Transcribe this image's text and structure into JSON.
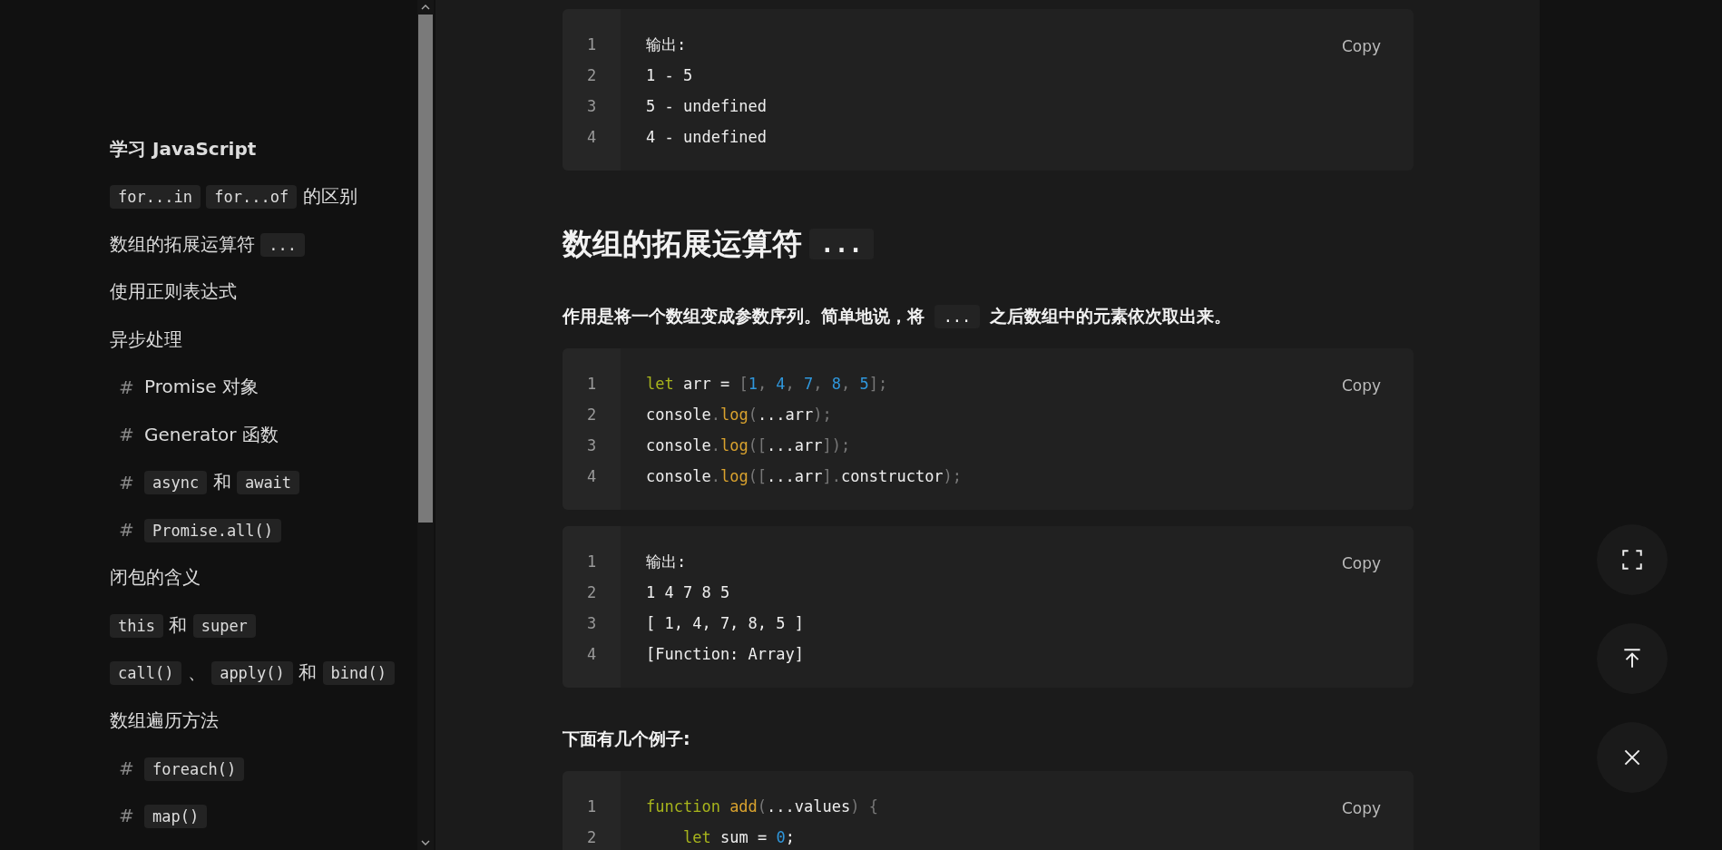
{
  "sidebar": {
    "items": [
      {
        "bold": true,
        "segments": [
          {
            "text": "学习 JavaScript"
          }
        ]
      },
      {
        "segments": [
          {
            "text": "for...in",
            "code": true
          },
          {
            "text": "for...of",
            "code": true
          },
          {
            "text": "的区别"
          }
        ]
      },
      {
        "segments": [
          {
            "text": "数组的拓展运算符"
          },
          {
            "text": "...",
            "code": true
          }
        ]
      },
      {
        "segments": [
          {
            "text": "使用正则表达式"
          }
        ]
      },
      {
        "segments": [
          {
            "text": "异步处理"
          }
        ]
      },
      {
        "marker": "#",
        "segments": [
          {
            "text": "Promise 对象"
          }
        ]
      },
      {
        "marker": "#",
        "segments": [
          {
            "text": "Generator 函数"
          }
        ]
      },
      {
        "marker": "#",
        "segments": [
          {
            "text": "async",
            "code": true
          },
          {
            "text": "和"
          },
          {
            "text": "await",
            "code": true
          }
        ]
      },
      {
        "marker": "#",
        "segments": [
          {
            "text": "Promise.all()",
            "code": true
          }
        ]
      },
      {
        "segments": [
          {
            "text": "闭包的含义"
          }
        ]
      },
      {
        "segments": [
          {
            "text": "this",
            "code": true
          },
          {
            "text": "和"
          },
          {
            "text": "super",
            "code": true
          }
        ]
      },
      {
        "segments": [
          {
            "text": "call()",
            "code": true
          },
          {
            "text": "、"
          },
          {
            "text": "apply()",
            "code": true
          },
          {
            "text": "和"
          },
          {
            "text": "bind()",
            "code": true
          }
        ]
      },
      {
        "segments": [
          {
            "text": "数组遍历方法"
          }
        ]
      },
      {
        "marker": "#",
        "segments": [
          {
            "text": "foreach()",
            "code": true
          }
        ]
      },
      {
        "marker": "#",
        "segments": [
          {
            "text": "map()",
            "code": true
          }
        ]
      }
    ]
  },
  "content": [
    {
      "kind": "code",
      "copy": "Copy",
      "lines": [
        {
          "number": "1",
          "tokens": [
            {
              "t": "输出:",
              "kind": "plain"
            }
          ]
        },
        {
          "number": "2",
          "tokens": [
            {
              "t": "1 - 5",
              "kind": "plain"
            }
          ]
        },
        {
          "number": "3",
          "tokens": [
            {
              "t": "5 - undefined",
              "kind": "plain"
            }
          ]
        },
        {
          "number": "4",
          "tokens": [
            {
              "t": "4 - undefined",
              "kind": "plain"
            }
          ]
        }
      ]
    },
    {
      "kind": "heading",
      "segments": [
        {
          "text": "数组的拓展运算符"
        },
        {
          "text": "...",
          "code": true
        }
      ]
    },
    {
      "kind": "paragraph",
      "segments": [
        {
          "text": "作用是将一个数组变成参数序列。简单地说，将"
        },
        {
          "text": "...",
          "code": true
        },
        {
          "text": "之后数组中的元素依次取出来。"
        }
      ]
    },
    {
      "kind": "code",
      "copy": "Copy",
      "lines": [
        {
          "number": "1",
          "tokens": [
            {
              "t": "let",
              "kind": "keyword"
            },
            {
              "t": " arr = ",
              "kind": "plain"
            },
            {
              "t": "[",
              "kind": "punct"
            },
            {
              "t": "1",
              "kind": "number"
            },
            {
              "t": ", ",
              "kind": "punct"
            },
            {
              "t": "4",
              "kind": "number"
            },
            {
              "t": ", ",
              "kind": "punct"
            },
            {
              "t": "7",
              "kind": "number"
            },
            {
              "t": ", ",
              "kind": "punct"
            },
            {
              "t": "8",
              "kind": "number"
            },
            {
              "t": ", ",
              "kind": "punct"
            },
            {
              "t": "5",
              "kind": "number"
            },
            {
              "t": "];",
              "kind": "punct"
            }
          ]
        },
        {
          "number": "2",
          "tokens": [
            {
              "t": "console",
              "kind": "plain"
            },
            {
              "t": ".",
              "kind": "punct"
            },
            {
              "t": "log",
              "kind": "function"
            },
            {
              "t": "(",
              "kind": "punct"
            },
            {
              "t": "...arr",
              "kind": "plain"
            },
            {
              "t": ");",
              "kind": "punct"
            }
          ]
        },
        {
          "number": "3",
          "tokens": [
            {
              "t": "console",
              "kind": "plain"
            },
            {
              "t": ".",
              "kind": "punct"
            },
            {
              "t": "log",
              "kind": "function"
            },
            {
              "t": "([",
              "kind": "punct"
            },
            {
              "t": "...arr",
              "kind": "plain"
            },
            {
              "t": "]);",
              "kind": "punct"
            }
          ]
        },
        {
          "number": "4",
          "tokens": [
            {
              "t": "console",
              "kind": "plain"
            },
            {
              "t": ".",
              "kind": "punct"
            },
            {
              "t": "log",
              "kind": "function"
            },
            {
              "t": "([",
              "kind": "punct"
            },
            {
              "t": "...arr",
              "kind": "plain"
            },
            {
              "t": "].",
              "kind": "punct"
            },
            {
              "t": "constructor",
              "kind": "plain"
            },
            {
              "t": ");",
              "kind": "punct"
            }
          ]
        }
      ]
    },
    {
      "kind": "code",
      "copy": "Copy",
      "lines": [
        {
          "number": "1",
          "tokens": [
            {
              "t": "输出:",
              "kind": "plain"
            }
          ]
        },
        {
          "number": "2",
          "tokens": [
            {
              "t": "1 4 7 8 5",
              "kind": "plain"
            }
          ]
        },
        {
          "number": "3",
          "tokens": [
            {
              "t": "[ 1, 4, 7, 8, 5 ]",
              "kind": "plain"
            }
          ]
        },
        {
          "number": "4",
          "tokens": [
            {
              "t": "[Function: Array]",
              "kind": "plain"
            }
          ]
        }
      ]
    },
    {
      "kind": "paragraph",
      "segments": [
        {
          "text": "下面有几个例子:"
        }
      ]
    },
    {
      "kind": "code",
      "copy": "Copy",
      "lines": [
        {
          "number": "1",
          "tokens": [
            {
              "t": "function",
              "kind": "keyword"
            },
            {
              "t": " add",
              "kind": "function"
            },
            {
              "t": "(",
              "kind": "punct"
            },
            {
              "t": "...values",
              "kind": "plain"
            },
            {
              "t": ") {",
              "kind": "punct"
            }
          ]
        },
        {
          "number": "2",
          "indent": true,
          "tokens": [
            {
              "t": "let",
              "kind": "keyword"
            },
            {
              "t": " sum = ",
              "kind": "plain"
            },
            {
              "t": "0",
              "kind": "number"
            },
            {
              "t": ";",
              "kind": "plain"
            }
          ]
        }
      ]
    }
  ],
  "floating_buttons": [
    {
      "kind": "fullscreen"
    },
    {
      "kind": "top"
    },
    {
      "kind": "close"
    }
  ]
}
